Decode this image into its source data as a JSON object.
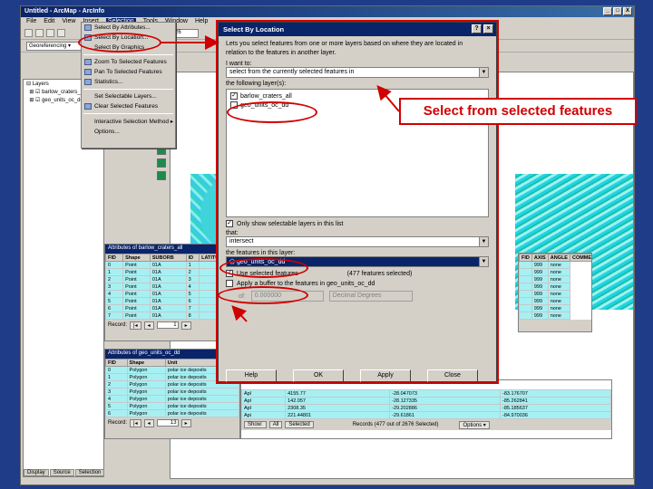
{
  "window": {
    "title": "Untitled - ArcMap - ArcInfo",
    "controls": [
      "_",
      "□",
      "X"
    ]
  },
  "menubar": [
    "File",
    "Edit",
    "View",
    "Insert",
    "Selection",
    "Tools",
    "Window",
    "Help"
  ],
  "toolbar": {
    "scale_value": "421,726",
    "georef_label": "Georeferencing ▾"
  },
  "selection_menu": [
    "Select By Attributes...",
    "Select By Location...",
    "Select By Graphics",
    "Zoom To Selected Features",
    "Pan To Selected Features",
    "Statistics...",
    "Set Selectable Layers...",
    "Clear Selected Features",
    "Interactive Selection Method ▸",
    "Options..."
  ],
  "toc": {
    "layers_label": "Layers",
    "rows": [
      "barlow_craters_all",
      "geo_units_oc_dd"
    ],
    "tabs": [
      "Display",
      "Source",
      "Selection"
    ]
  },
  "attr_table_1": {
    "title": "Attributes of barlow_craters_all",
    "columns": [
      "FID",
      "Shape",
      "SUBORB",
      "ID",
      "LATITUDE"
    ],
    "rows": [
      [
        "0",
        "Point",
        "01A",
        "1",
        ""
      ],
      [
        "1",
        "Point",
        "01A",
        "2",
        ""
      ],
      [
        "2",
        "Point",
        "01A",
        "3",
        ""
      ],
      [
        "3",
        "Point",
        "01A",
        "4",
        ""
      ],
      [
        "4",
        "Point",
        "01A",
        "5",
        ""
      ],
      [
        "5",
        "Point",
        "01A",
        "6",
        ""
      ],
      [
        "6",
        "Point",
        "01A",
        "7",
        ""
      ],
      [
        "7",
        "Point",
        "01A",
        "8",
        ""
      ]
    ],
    "right_columns": [
      "FID",
      "AXIS",
      "ANGLE",
      "COMMENTS"
    ],
    "right_rows": [
      [
        "",
        "999",
        "none"
      ],
      [
        "",
        "999",
        "none"
      ],
      [
        "",
        "999",
        "none"
      ],
      [
        "",
        "999",
        "none"
      ],
      [
        "",
        "999",
        "none"
      ],
      [
        "",
        "999",
        "none"
      ],
      [
        "",
        "999",
        "none"
      ],
      [
        "",
        "999",
        "none"
      ]
    ],
    "record_label": "Record:",
    "record_value": "1"
  },
  "attr_table_2": {
    "title": "Attributes of geo_units_oc_dd",
    "columns": [
      "FID",
      "Shape",
      "Unit"
    ],
    "rows": [
      [
        "0",
        "Polygon",
        "polar ice deposits"
      ],
      [
        "1",
        "Polygon",
        "polar ice deposits"
      ],
      [
        "2",
        "Polygon",
        "polar ice deposits"
      ],
      [
        "3",
        "Polygon",
        "polar ice deposits"
      ],
      [
        "4",
        "Polygon",
        "polar ice deposits"
      ],
      [
        "5",
        "Polygon",
        "polar ice deposits"
      ],
      [
        "6",
        "Polygon",
        "polar ice deposits"
      ]
    ],
    "extra_rows": [
      [
        "Apl",
        "4155.77",
        "-28.047073",
        "-83.176707"
      ],
      [
        "Apl",
        "142.057",
        "-28.127335",
        "-85.262841"
      ],
      [
        "Apl",
        "2308.35",
        "-29.202886",
        "-85.185637"
      ],
      [
        "Api",
        "221.44801",
        "-29.61861",
        "-84.970036"
      ]
    ],
    "record_label": "Record:",
    "record_value": "13",
    "show_buttons": [
      "Show:",
      "All",
      "Selected"
    ],
    "records_status": "Records (477 out of 2676 Selected)",
    "options_label": "Options ▾"
  },
  "dialog": {
    "title": "Select By Location",
    "intro": "Lets you select features from one or more layers based on where they are located in relation to the features in another layer.",
    "i_want_to_label": "I want to:",
    "i_want_to_value": "select from the currently selected features in",
    "layers_label": "the following layer(s):",
    "layers": [
      {
        "name": "barlow_craters_all",
        "checked": true
      },
      {
        "name": "geo_units_oc_dd",
        "checked": false
      }
    ],
    "only_show_label": "Only show selectable layers in this list",
    "that_label": "that:",
    "that_value": "intersect",
    "features_label": "the features in this layer:",
    "features_value": "geo_units_oc_dd",
    "use_selected_label": "Use selected features",
    "selected_count": "(477 features selected)",
    "apply_buffer_label": "Apply a buffer to the features in geo_units_oc_dd",
    "of_label": "of:",
    "buffer_value": "0.000000",
    "units_value": "Decimal Degrees",
    "buttons": [
      "Help",
      "OK",
      "Apply",
      "Close"
    ]
  },
  "callout": {
    "text": "Select from selected features"
  },
  "colors": {
    "accent": "#d00000",
    "titlebar": "#0a246a",
    "selection_highlight": "#a6f0f3"
  }
}
